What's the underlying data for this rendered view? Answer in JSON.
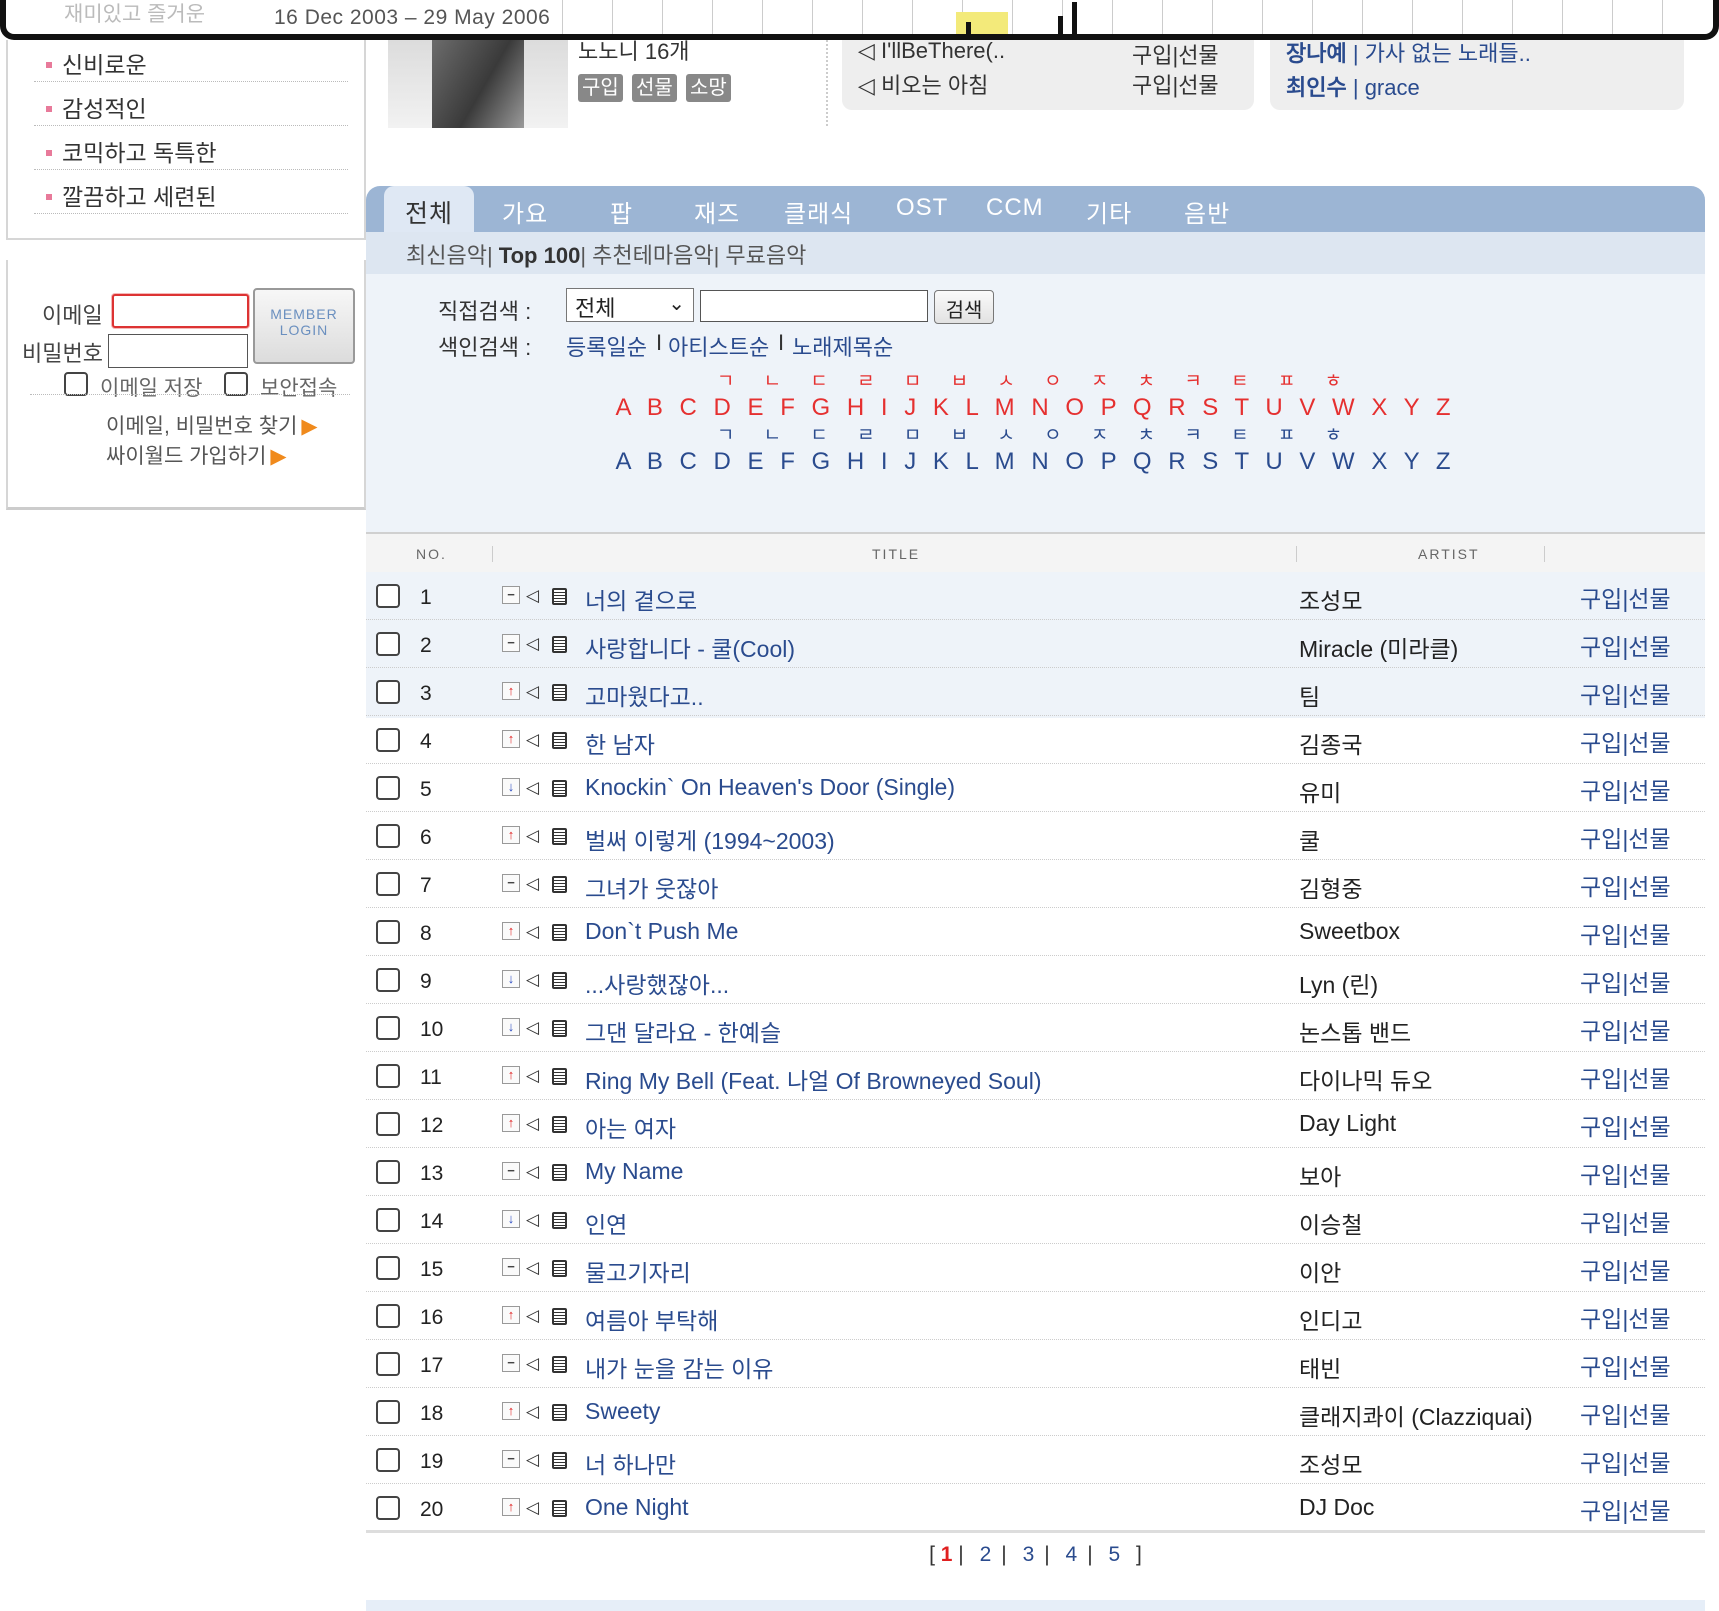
{
  "wayback": {
    "range": "16 Dec 2003 – 29 May 2006",
    "faded": "재미있고 즐거운"
  },
  "sidebar": {
    "menu": [
      "신비로운",
      "감성적인",
      "코믹하고 독특한",
      "깔끔하고 세련된"
    ],
    "login": {
      "email_label": "이메일",
      "password_label": "비밀번호",
      "member_login": "MEMBER\nLOGIN",
      "save_email": "이메일 저장",
      "secure": "보안접속",
      "find": "이메일, 비밀번호 찾기",
      "join": "싸이월드 가입하기"
    }
  },
  "top": {
    "album_title": "노노니 16개",
    "pills": [
      "구입",
      "선물",
      "소망"
    ],
    "card1": [
      {
        "song": "I'llBeThere(..",
        "buy": "구입|선물"
      },
      {
        "song": "비오는 아침",
        "buy": "구입|선물"
      }
    ],
    "card2": [
      {
        "artist": "장나예",
        "text": "가사 없는 노래들.."
      },
      {
        "artist": "최인수",
        "text": "grace"
      }
    ]
  },
  "tabs": [
    "전체",
    "가요",
    "팝",
    "재즈",
    "클래식",
    "OST",
    "CCM",
    "기타",
    "음반"
  ],
  "subnav": {
    "items": [
      "최신음악",
      "Top 100",
      "추천테마음악",
      "무료음악"
    ]
  },
  "search": {
    "direct_label": "직접검색 :",
    "select_value": "전체",
    "button": "검색",
    "index_label": "색인검색 :",
    "index_links": [
      "등록일순",
      "아티스트순",
      "노래제목순"
    ],
    "korean": "ㄱ ㄴ ㄷ ㄹ ㅁ ㅂ ㅅ ㅇ ㅈ ㅊ ㅋ ㅌ ㅍ ㅎ",
    "latin": "A B C D E F G H I J K L M N O P Q R S T U V W X Y Z"
  },
  "list_head": {
    "no": "NO.",
    "title": "TITLE",
    "artist": "ARTIST"
  },
  "buy_label": "구입|선물",
  "rows": [
    {
      "no": "1",
      "rank": "same",
      "title": "너의 곁으로",
      "artist": "조성모"
    },
    {
      "no": "2",
      "rank": "same",
      "title": "사랑합니다 - 쿨(Cool)",
      "artist": "Miracle (미라클)"
    },
    {
      "no": "3",
      "rank": "up",
      "title": "고마웠다고..",
      "artist": "팀"
    },
    {
      "no": "4",
      "rank": "up",
      "title": "한 남자",
      "artist": "김종국"
    },
    {
      "no": "5",
      "rank": "down",
      "title": "Knockin` On Heaven's Door (Single)",
      "artist": "유미"
    },
    {
      "no": "6",
      "rank": "up",
      "title": "벌써 이렇게 (1994~2003)",
      "artist": "쿨"
    },
    {
      "no": "7",
      "rank": "same",
      "title": "그녀가 웃잖아",
      "artist": "김형중"
    },
    {
      "no": "8",
      "rank": "up",
      "title": "Don`t Push Me",
      "artist": "Sweetbox"
    },
    {
      "no": "9",
      "rank": "down",
      "title": "...사랑했잖아...",
      "artist": "Lyn (린)"
    },
    {
      "no": "10",
      "rank": "down",
      "title": "그댄 달라요 - 한예슬",
      "artist": "논스톱 밴드"
    },
    {
      "no": "11",
      "rank": "up",
      "title": "Ring My Bell (Feat. 나얼 Of Browneyed Soul)",
      "artist": "다이나믹 듀오"
    },
    {
      "no": "12",
      "rank": "up",
      "title": "아는 여자",
      "artist": "Day Light"
    },
    {
      "no": "13",
      "rank": "same",
      "title": "My Name",
      "artist": "보아"
    },
    {
      "no": "14",
      "rank": "down",
      "title": "인연",
      "artist": "이승철"
    },
    {
      "no": "15",
      "rank": "same",
      "title": "물고기자리",
      "artist": "이안"
    },
    {
      "no": "16",
      "rank": "up",
      "title": "여름아 부탁해",
      "artist": "인디고"
    },
    {
      "no": "17",
      "rank": "same",
      "title": "내가 눈을 감는 이유",
      "artist": "태빈"
    },
    {
      "no": "18",
      "rank": "up",
      "title": "Sweety",
      "artist": "클래지콰이 (Clazziquai)"
    },
    {
      "no": "19",
      "rank": "same",
      "title": "너 하나만",
      "artist": "조성모"
    },
    {
      "no": "20",
      "rank": "up",
      "title": "One Night",
      "artist": "DJ Doc"
    }
  ],
  "pager": {
    "current": "1",
    "pages": [
      "2",
      "3",
      "4",
      "5"
    ]
  },
  "icons": {
    "rank_up": "↑",
    "rank_down": "↓",
    "rank_same": "−",
    "speaker": "speaker-icon",
    "lyrics": "lyrics-icon",
    "arrow": "▶"
  }
}
